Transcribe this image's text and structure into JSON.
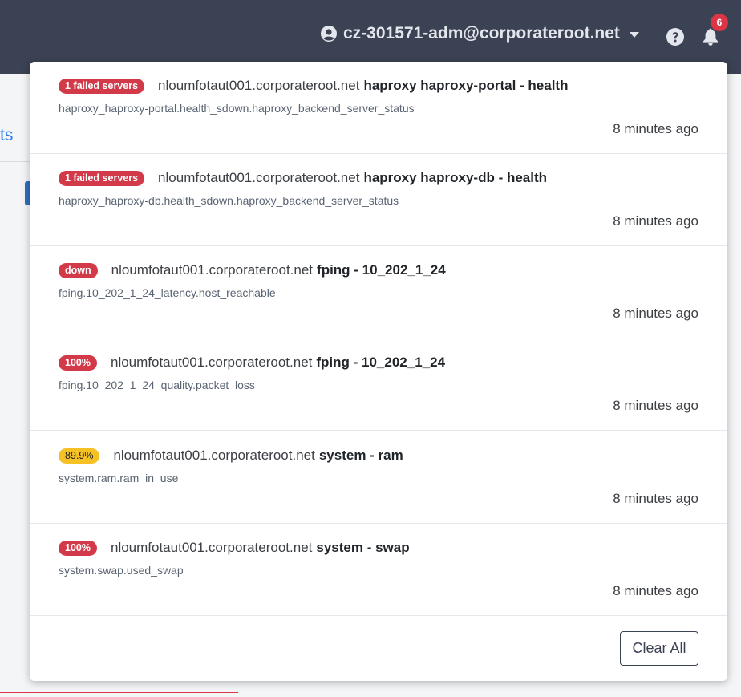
{
  "header": {
    "user_label": "cz-301571-adm@corporateroot.net",
    "notification_count": "6"
  },
  "background": {
    "fragment_text": "ts"
  },
  "notifications": [
    {
      "badge": "1 failed servers",
      "badge_level": "critical",
      "host": "nloumfotaut001.corporateroot.net",
      "check": "haproxy haproxy-portal - health",
      "metric": "haproxy_haproxy-portal.health_sdown.haproxy_backend_server_status",
      "time": "8 minutes ago"
    },
    {
      "badge": "1 failed servers",
      "badge_level": "critical",
      "host": "nloumfotaut001.corporateroot.net",
      "check": "haproxy haproxy-db - health",
      "metric": "haproxy_haproxy-db.health_sdown.haproxy_backend_server_status",
      "time": "8 minutes ago"
    },
    {
      "badge": "down",
      "badge_level": "critical",
      "host": "nloumfotaut001.corporateroot.net",
      "check": "fping - 10_202_1_24",
      "metric": "fping.10_202_1_24_latency.host_reachable",
      "time": "8 minutes ago"
    },
    {
      "badge": "100%",
      "badge_level": "critical",
      "host": "nloumfotaut001.corporateroot.net",
      "check": "fping - 10_202_1_24",
      "metric": "fping.10_202_1_24_quality.packet_loss",
      "time": "8 minutes ago"
    },
    {
      "badge": "89.9%",
      "badge_level": "warning",
      "host": "nloumfotaut001.corporateroot.net",
      "check": "system - ram",
      "metric": "system.ram.ram_in_use",
      "time": "8 minutes ago"
    },
    {
      "badge": "100%",
      "badge_level": "critical",
      "host": "nloumfotaut001.corporateroot.net",
      "check": "system - swap",
      "metric": "system.swap.used_swap",
      "time": "8 minutes ago"
    }
  ],
  "actions": {
    "clear_all_label": "Clear All"
  },
  "colors": {
    "topbar": "#3b4253",
    "critical": "#d23a4a",
    "warning": "#f5c124",
    "badge_count": "#dc3545"
  },
  "icons": {
    "user": "user-circle-icon",
    "caret": "caret-down-icon",
    "help": "question-circle-icon",
    "bell": "bell-icon"
  }
}
